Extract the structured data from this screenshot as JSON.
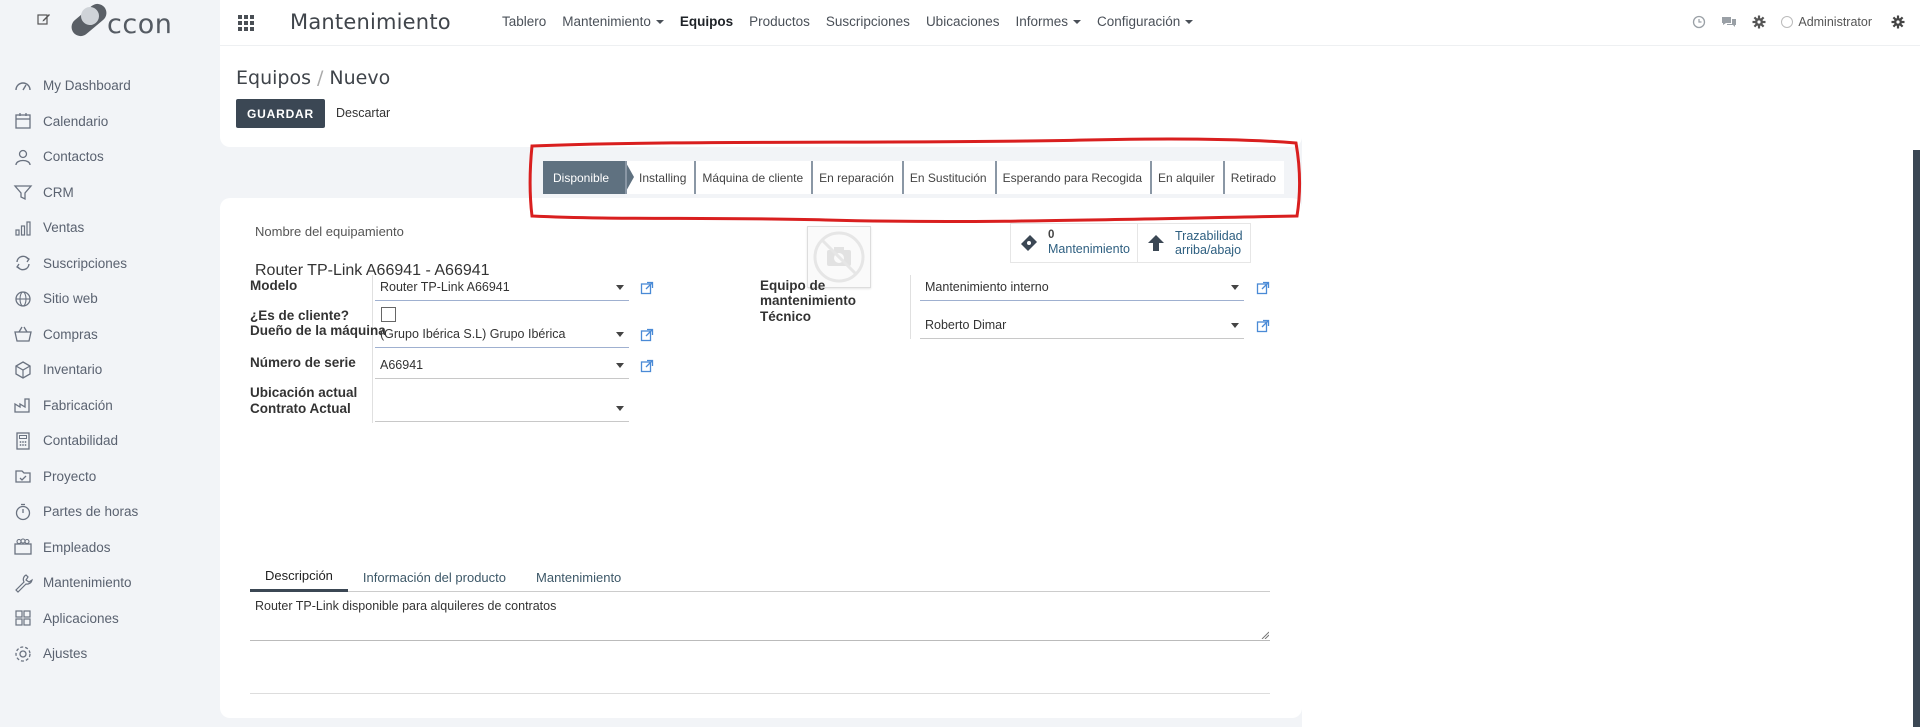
{
  "logo": {
    "text": "ccon"
  },
  "sidebar": {
    "items": [
      {
        "label": "My Dashboard",
        "icon": "dashboard-icon"
      },
      {
        "label": "Calendario",
        "icon": "calendar-icon"
      },
      {
        "label": "Contactos",
        "icon": "contacts-icon"
      },
      {
        "label": "CRM",
        "icon": "crm-funnel-icon"
      },
      {
        "label": "Ventas",
        "icon": "sales-chart-icon"
      },
      {
        "label": "Suscripciones",
        "icon": "subscriptions-icon"
      },
      {
        "label": "Sitio web",
        "icon": "website-globe-icon"
      },
      {
        "label": "Compras",
        "icon": "purchase-basket-icon"
      },
      {
        "label": "Inventario",
        "icon": "inventory-box-icon"
      },
      {
        "label": "Fabricación",
        "icon": "manufacturing-icon"
      },
      {
        "label": "Contabilidad",
        "icon": "accounting-icon"
      },
      {
        "label": "Proyecto",
        "icon": "project-icon"
      },
      {
        "label": "Partes de horas",
        "icon": "timesheet-icon"
      },
      {
        "label": "Empleados",
        "icon": "employees-icon"
      },
      {
        "label": "Mantenimiento",
        "icon": "maintenance-wrench-icon"
      },
      {
        "label": "Aplicaciones",
        "icon": "apps-icon"
      },
      {
        "label": "Ajustes",
        "icon": "settings-gear-icon"
      }
    ]
  },
  "topbar": {
    "app_title": "Mantenimiento",
    "menu": [
      {
        "label": "Tablero",
        "dropdown": false,
        "active": false
      },
      {
        "label": "Mantenimiento",
        "dropdown": true,
        "active": false
      },
      {
        "label": "Equipos",
        "dropdown": false,
        "active": true
      },
      {
        "label": "Productos",
        "dropdown": false,
        "active": false
      },
      {
        "label": "Suscripciones",
        "dropdown": false,
        "active": false
      },
      {
        "label": "Ubicaciones",
        "dropdown": false,
        "active": false
      },
      {
        "label": "Informes",
        "dropdown": true,
        "active": false
      },
      {
        "label": "Configuración",
        "dropdown": true,
        "active": false
      }
    ],
    "user": "Administrator"
  },
  "breadcrumb": {
    "parent": "Equipos",
    "current": "Nuevo",
    "separator": "/"
  },
  "actions": {
    "save": "GUARDAR",
    "discard": "Descartar"
  },
  "statusbar": {
    "stages": [
      "Disponible",
      "Installing",
      "Máquina de cliente",
      "En reparación",
      "En Sustitución",
      "Esperando para Recogida",
      "En alquiler",
      "Retirado"
    ],
    "active_index": 0
  },
  "form": {
    "name_label": "Nombre del equipamiento",
    "name_value": "Router TP-Link A66941 - A66941",
    "smart_buttons": {
      "maintenance_count": "0",
      "maintenance_label": "Mantenimiento",
      "traceability_label_1": "Trazabilidad",
      "traceability_label_2": "arriba/abajo"
    },
    "fields": {
      "modelo_label": "Modelo",
      "modelo_value": "Router TP-Link A66941",
      "es_cliente_label": "¿Es de cliente?",
      "es_cliente_checked": false,
      "dueno_label": "Dueño de la máquina",
      "dueno_value": "(Grupo Ibérica  S.L) Grupo Ibérica",
      "serie_label": "Número de serie",
      "serie_value": "A66941",
      "ubicacion_label": "Ubicación actual",
      "contrato_label": "Contrato Actual",
      "contrato_value": "",
      "equipo_label_1": "Equipo de",
      "equipo_label_2": "mantenimiento",
      "equipo_value": "Mantenimiento interno",
      "tecnico_label": "Técnico",
      "tecnico_value": "Roberto Dimar"
    },
    "tabs": [
      {
        "label": "Descripción",
        "active": true
      },
      {
        "label": "Información del producto",
        "active": false
      },
      {
        "label": "Mantenimiento",
        "active": false
      }
    ],
    "description": "Router TP-Link disponible para alquileres de contratos"
  },
  "colors": {
    "primary": "#3b4754",
    "status_active": "#5f7180",
    "link": "#2e5f80",
    "annotation": "#d91f1f"
  }
}
